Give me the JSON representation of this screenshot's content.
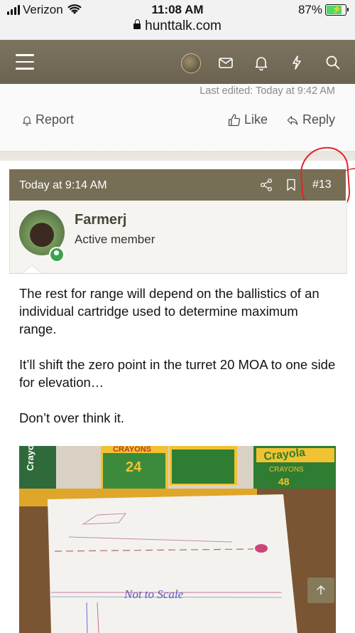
{
  "status_bar": {
    "carrier": "Verizon",
    "time": "11:08 AM",
    "battery": "87%",
    "battery_level": 0.87
  },
  "browser": {
    "url": "hunttalk.com"
  },
  "nav": {
    "icons": [
      "menu-icon",
      "avatar",
      "mail-icon",
      "bell-icon",
      "bolt-icon",
      "search-icon"
    ]
  },
  "previous_post": {
    "last_edited": "Last edited: Today at 9:42 AM",
    "report_label": "Report",
    "like_label": "Like",
    "reply_label": "Reply"
  },
  "post": {
    "date": "Today at 9:14 AM",
    "number": "#13",
    "author": {
      "name": "Farmerj",
      "title": "Active member"
    },
    "paragraphs": [
      "The rest for range will depend on the ballistics of an individual cartridge used to determine maximum range.",
      "It’ll shift the zero point in the turret 20 MOA to one side for elevation…",
      "Don’t over think it."
    ],
    "image_text": {
      "box_left": "Crayola",
      "box_1": "CRAYONS",
      "box_1_count": "24",
      "box_3": "Crayola",
      "box_3_sub": "CRAYONS",
      "box_3_count": "48",
      "sketch_label": "Not to Scale"
    }
  },
  "colors": {
    "nav_bg": "#766f55",
    "annotation": "#e0242b",
    "online": "#3fa24c"
  }
}
